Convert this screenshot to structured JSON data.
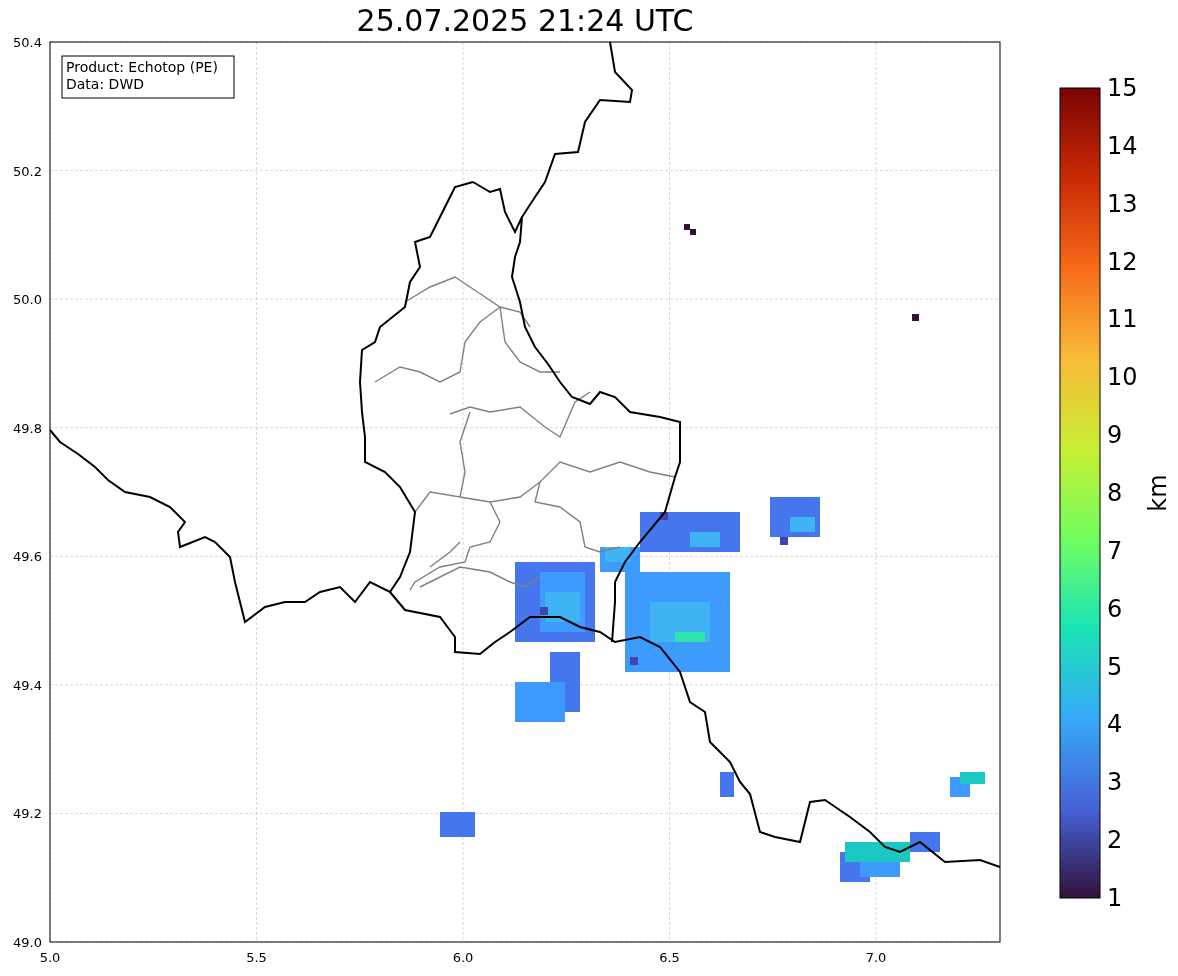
{
  "title": "25.07.2025 21:24 UTC",
  "legend": [
    "Product: Echotop (PE)",
    "Data: DWD"
  ],
  "map": {
    "xticks": [
      "5.0",
      "5.5",
      "6.0",
      "6.5",
      "7.0"
    ],
    "yticks": [
      "50.4",
      "50.2",
      "50.0",
      "49.8",
      "49.6",
      "49.4",
      "49.2",
      "49.0"
    ]
  },
  "colorbar": {
    "ticks": [
      "15",
      "14",
      "13",
      "12",
      "11",
      "10",
      "9",
      "8",
      "7",
      "6",
      "5",
      "4",
      "3",
      "2",
      "1"
    ],
    "label": "km"
  }
}
